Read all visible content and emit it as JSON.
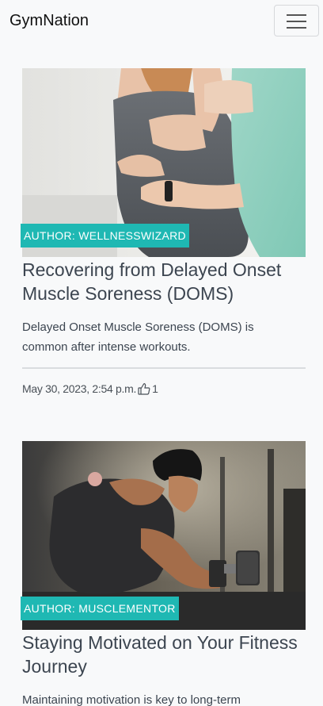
{
  "navbar": {
    "brand": "GymNation",
    "toggle_icon": "hamburger-menu-icon"
  },
  "posts": [
    {
      "image_alt": "Therapist massaging a person's back",
      "author_badge": "AUTHOR: WELLNESSWIZARD",
      "title": "Recovering from Delayed Onset Muscle Soreness (DOMS)",
      "excerpt": "Delayed Onset Muscle Soreness (DOMS) is common after intense workouts.",
      "timestamp": "May 30, 2023, 2:54 p.m.",
      "likes": "1",
      "like_icon": "thumbs-up-icon"
    },
    {
      "image_alt": "Man lifting a dumbbell in a gym",
      "author_badge": "AUTHOR: MUSCLEMENTOR",
      "title": "Staying Motivated on Your Fitness Journey",
      "excerpt": "Maintaining motivation is key to long-term"
    }
  ],
  "colors": {
    "accent": "#1fb8b3",
    "title": "#3c4550",
    "background": "#f8f9fa"
  }
}
